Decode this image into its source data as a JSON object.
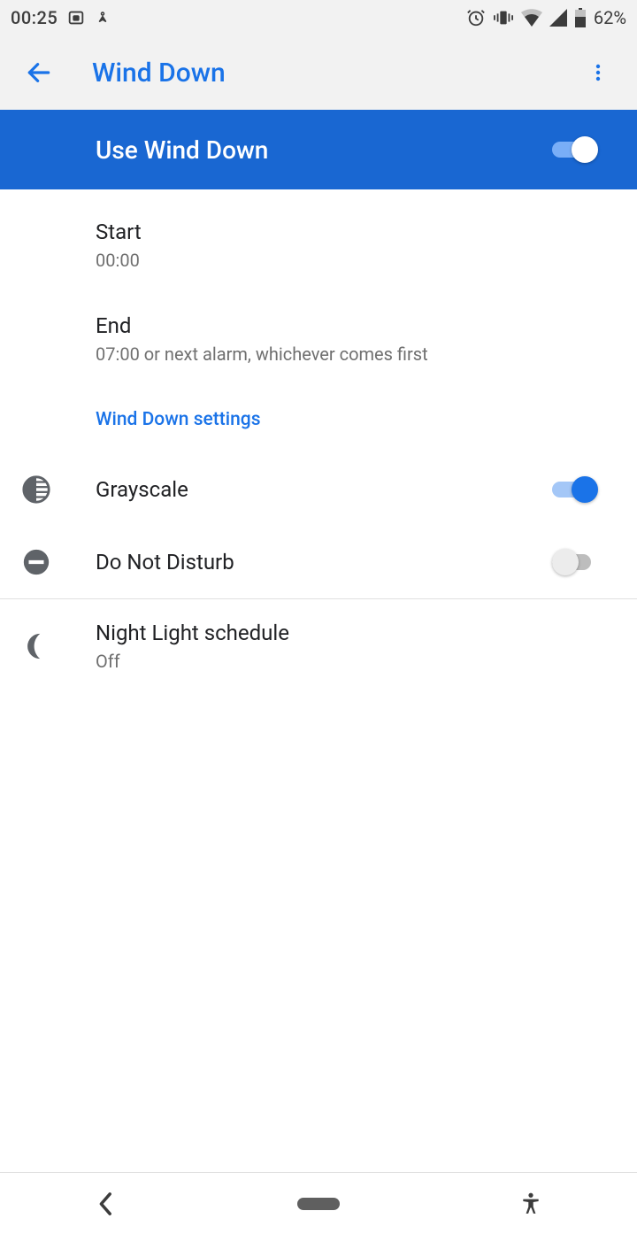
{
  "status": {
    "time": "00:25",
    "battery": "62%"
  },
  "header": {
    "title": "Wind Down"
  },
  "master": {
    "label": "Use Wind Down",
    "enabled": true
  },
  "items": {
    "start": {
      "label": "Start",
      "value": "00:00"
    },
    "end": {
      "label": "End",
      "value": "07:00 or next alarm, whichever comes first"
    },
    "section": "Wind Down settings",
    "grayscale": {
      "label": "Grayscale",
      "enabled": true
    },
    "dnd": {
      "label": "Do Not Disturb",
      "enabled": false
    },
    "nightlight": {
      "label": "Night Light schedule",
      "value": "Off"
    }
  }
}
